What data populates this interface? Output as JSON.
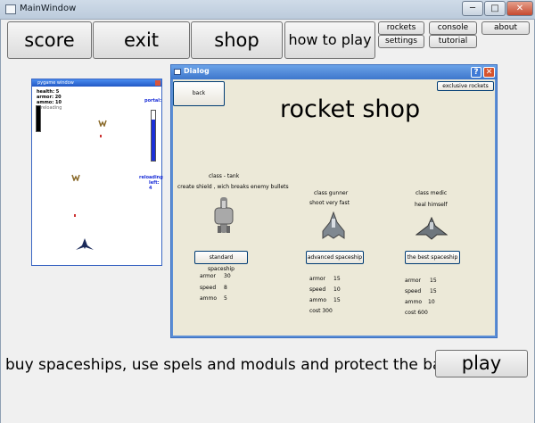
{
  "window": {
    "title": "MainWindow",
    "controls": {
      "minimize": "─",
      "maximize": "□",
      "close": "✕"
    }
  },
  "toolbar": {
    "score": "score",
    "exit": "exit",
    "shop": "shop",
    "how_to_play": "how to play",
    "rockets": "rockets",
    "settings": "settings",
    "console": "console",
    "tutorial": "tutorial",
    "about": "about"
  },
  "game_window": {
    "title": "pygame window",
    "stats": {
      "health": "health: 5",
      "armor": "armor: 20",
      "ammo": "ammo: 10",
      "reloading": "reloading"
    },
    "portal_label": "portal:",
    "reloading_label": "reloading",
    "left_label": "left: 4"
  },
  "dialog": {
    "title": "Dialog",
    "help": "?",
    "close": "✕",
    "back_label": "back",
    "exclusive_label": "exclusive rockets",
    "heading": "rocket shop",
    "ships": [
      {
        "class_name": "class - tank",
        "description": "create shield , wich breaks enemy bullets",
        "buy_label": "standard spaceship",
        "armor": "armor",
        "armor_val": "30",
        "speed": "speed",
        "speed_val": "8",
        "ammo": "ammo",
        "ammo_val": "5",
        "cost": ""
      },
      {
        "class_name": "class gunner",
        "description": "shoot very fast",
        "buy_label": "advanced spaceship",
        "armor": "armor",
        "armor_val": "15",
        "speed": "speed",
        "speed_val": "10",
        "ammo": "ammo",
        "ammo_val": "15",
        "cost": "cost 300"
      },
      {
        "class_name": "class medic",
        "description": "heal himself",
        "buy_label": "the best spaceship",
        "armor": "armor",
        "armor_val": "15",
        "speed": "speed",
        "speed_val": "15",
        "ammo": "ammo",
        "ammo_val": "10",
        "cost": "cost 600"
      }
    ]
  },
  "footer": {
    "message": "buy spaceships, use spels and moduls and protect the base!",
    "play_label": "play"
  }
}
